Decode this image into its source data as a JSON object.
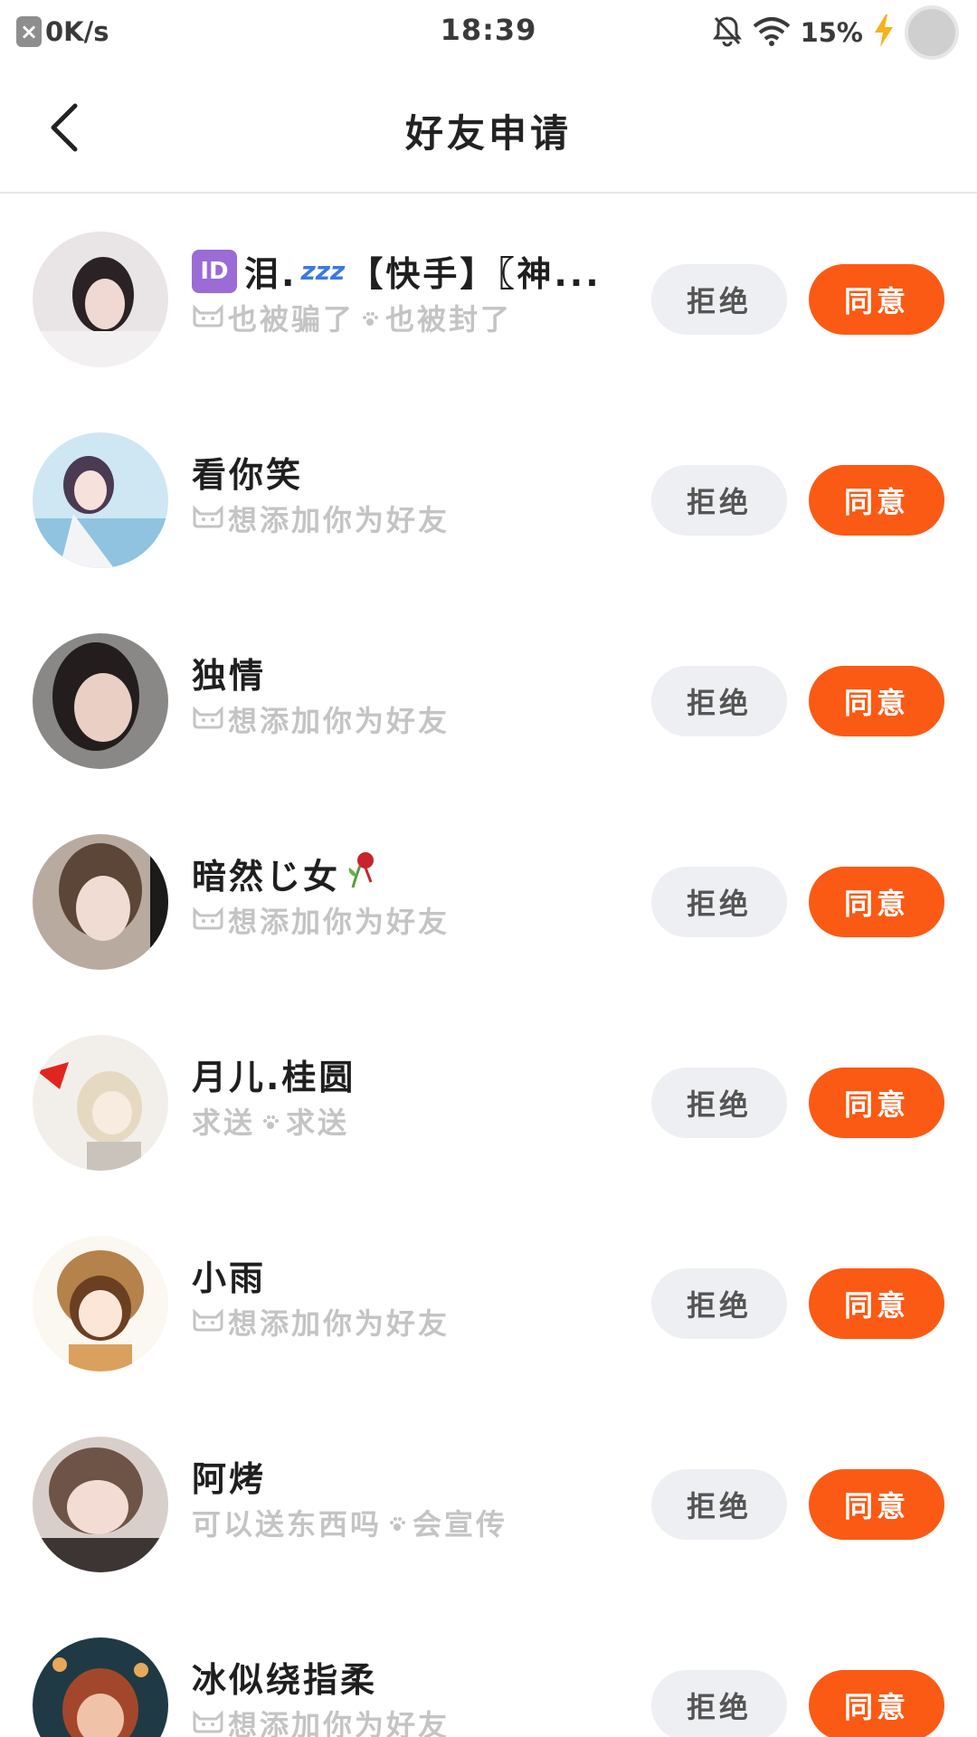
{
  "status_bar": {
    "net_speed": "0K/s",
    "time": "18:39",
    "battery": "15%"
  },
  "header": {
    "title": "好友申请"
  },
  "colors": {
    "accept": "#fb5a14",
    "reject_bg": "#eeeff3",
    "message": "#c4c4c4"
  },
  "buttons": {
    "reject": "拒绝",
    "accept": "同意"
  },
  "requests": [
    {
      "name": "泪.",
      "name_tail": "【快手】〖神...",
      "message": "也被骗了",
      "message_tail": "也被封了",
      "badge": "ID",
      "icons": [
        "cat-icon",
        "paw-icon",
        "zzz-icon"
      ]
    },
    {
      "name": "看你笑",
      "message": "想添加你为好友",
      "icons": [
        "cat-icon"
      ]
    },
    {
      "name": "独情",
      "message": "想添加你为好友",
      "icons": [
        "cat-icon"
      ]
    },
    {
      "name": "暗然じ女",
      "message": "想添加你为好友",
      "icons": [
        "cat-icon",
        "rose-icon"
      ]
    },
    {
      "name": "月儿.桂圆",
      "message": "求送",
      "message_tail": "求送",
      "icons": [
        "paw-icon"
      ]
    },
    {
      "name": "小雨",
      "message": "想添加你为好友",
      "icons": [
        "cat-icon"
      ]
    },
    {
      "name": "阿烤",
      "message": "可以送东西吗",
      "message_tail": "会宣传",
      "icons": [
        "paw-icon"
      ]
    },
    {
      "name": "冰似绕指柔",
      "message": "想添加你为好友",
      "icons": [
        "cat-icon"
      ]
    }
  ]
}
